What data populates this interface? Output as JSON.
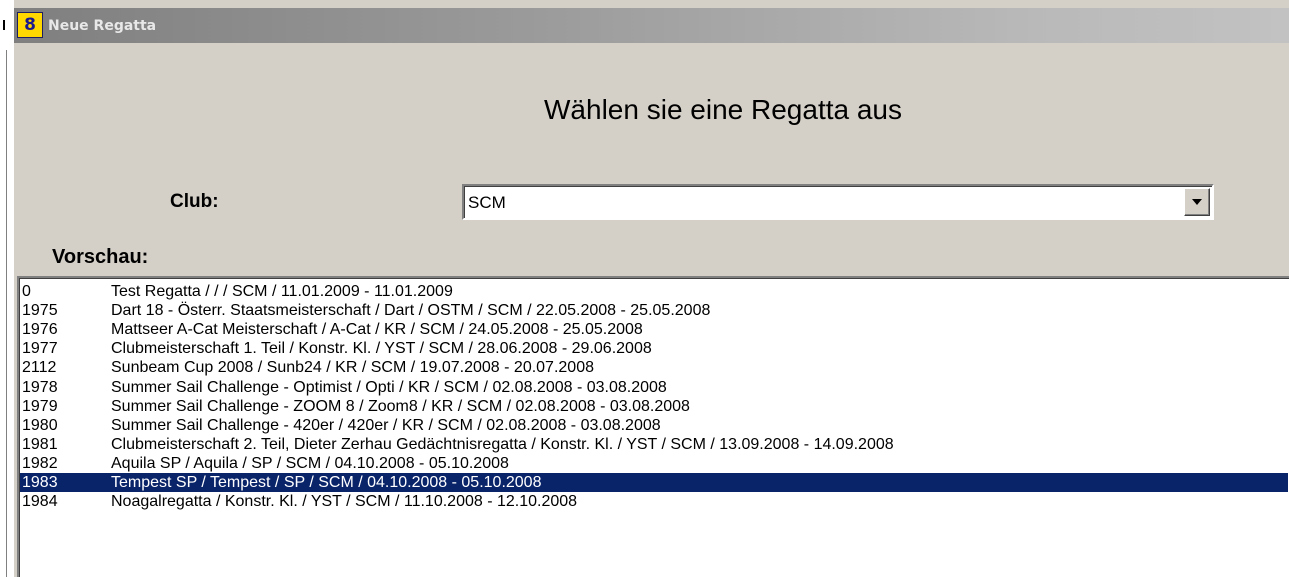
{
  "window": {
    "title": "Neue Regatta",
    "icon": "app-icon",
    "icon_glyph": "8"
  },
  "heading": "Wählen sie eine Regatta aus",
  "club": {
    "label": "Club:",
    "value": "SCM"
  },
  "preview": {
    "label": "Vorschau:",
    "rows": [
      {
        "nr": "0",
        "text": "Test Regatta /  /  / SCM / 11.01.2009 - 11.01.2009",
        "selected": false
      },
      {
        "nr": "1975",
        "text": "Dart 18 - Österr. Staatsmeisterschaft / Dart / OSTM / SCM / 22.05.2008 - 25.05.2008",
        "selected": false
      },
      {
        "nr": "1976",
        "text": "Mattseer A-Cat Meisterschaft / A-Cat / KR / SCM / 24.05.2008 - 25.05.2008",
        "selected": false
      },
      {
        "nr": "1977",
        "text": "Clubmeisterschaft 1. Teil / Konstr. Kl. / YST / SCM / 28.06.2008 - 29.06.2008",
        "selected": false
      },
      {
        "nr": "2112",
        "text": "Sunbeam Cup 2008 / Sunb24 / KR / SCM / 19.07.2008 - 20.07.2008",
        "selected": false
      },
      {
        "nr": "1978",
        "text": "Summer Sail Challenge - Optimist / Opti / KR / SCM / 02.08.2008 - 03.08.2008",
        "selected": false
      },
      {
        "nr": "1979",
        "text": "Summer Sail Challenge - ZOOM 8 / Zoom8 / KR / SCM / 02.08.2008 - 03.08.2008",
        "selected": false
      },
      {
        "nr": "1980",
        "text": "Summer Sail Challenge - 420er / 420er / KR / SCM / 02.08.2008 - 03.08.2008",
        "selected": false
      },
      {
        "nr": "1981",
        "text": "Clubmeisterschaft 2. Teil, Dieter Zerhau Gedächtnisregatta / Konstr. Kl. / YST / SCM / 13.09.2008 - 14.09.2008",
        "selected": false
      },
      {
        "nr": "1982",
        "text": "Aquila SP / Aquila / SP / SCM / 04.10.2008 - 05.10.2008",
        "selected": false
      },
      {
        "nr": "1983",
        "text": "Tempest SP / Tempest / SP / SCM / 04.10.2008 - 05.10.2008",
        "selected": true
      },
      {
        "nr": "1984",
        "text": "Noagalregatta / Konstr. Kl. / YST / SCM / 11.10.2008 - 12.10.2008",
        "selected": false
      }
    ]
  },
  "colors": {
    "dialog_bg": "#d4d0c8",
    "selection_bg": "#0a246a",
    "selection_fg": "#ffffff"
  }
}
